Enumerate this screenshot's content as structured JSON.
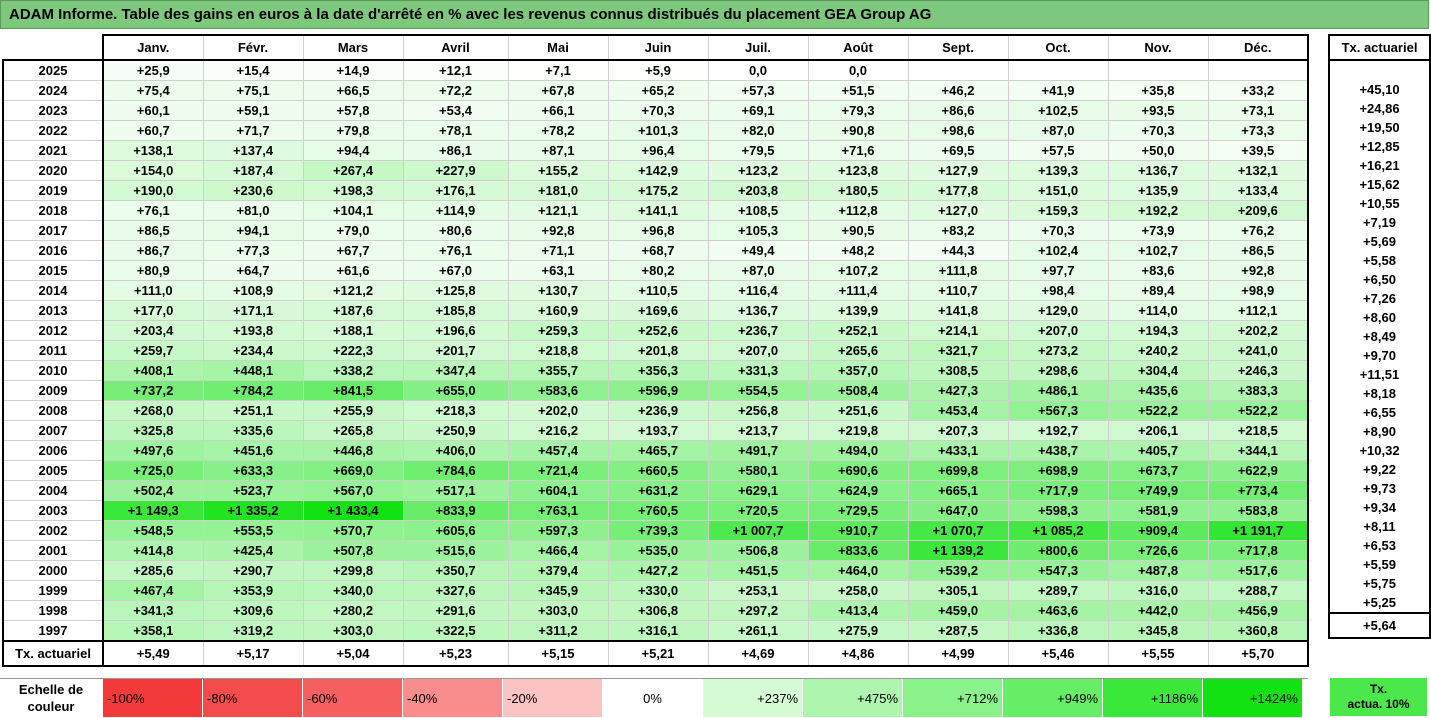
{
  "title": "ADAM Informe. Table des gains en euros à la date d'arrêté en % avec les revenus connus distribués du placement GEA Group AG",
  "months": [
    "Janv.",
    "Févr.",
    "Mars",
    "Avril",
    "Mai",
    "Juin",
    "Juil.",
    "Août",
    "Sept.",
    "Oct.",
    "Nov.",
    "Déc."
  ],
  "rate_header": "Tx. actuariel",
  "rows": [
    {
      "year": "2025",
      "values": [
        "+25,9",
        "+15,4",
        "+14,9",
        "+12,1",
        "+7,1",
        "+5,9",
        "0,0",
        "0,0",
        "",
        "",
        "",
        ""
      ],
      "rate": ""
    },
    {
      "year": "2024",
      "values": [
        "+75,4",
        "+75,1",
        "+66,5",
        "+72,2",
        "+67,8",
        "+65,2",
        "+57,3",
        "+51,5",
        "+46,2",
        "+41,9",
        "+35,8",
        "+33,2"
      ],
      "rate": "+45,10"
    },
    {
      "year": "2023",
      "values": [
        "+60,1",
        "+59,1",
        "+57,8",
        "+53,4",
        "+66,1",
        "+70,3",
        "+69,1",
        "+79,3",
        "+86,6",
        "+102,5",
        "+93,5",
        "+73,1"
      ],
      "rate": "+24,86"
    },
    {
      "year": "2022",
      "values": [
        "+60,7",
        "+71,7",
        "+79,8",
        "+78,1",
        "+78,2",
        "+101,3",
        "+82,0",
        "+90,8",
        "+98,6",
        "+87,0",
        "+70,3",
        "+73,3"
      ],
      "rate": "+19,50"
    },
    {
      "year": "2021",
      "values": [
        "+138,1",
        "+137,4",
        "+94,4",
        "+86,1",
        "+87,1",
        "+96,4",
        "+79,5",
        "+71,6",
        "+69,5",
        "+57,5",
        "+50,0",
        "+39,5"
      ],
      "rate": "+12,85"
    },
    {
      "year": "2020",
      "values": [
        "+154,0",
        "+187,4",
        "+267,4",
        "+227,9",
        "+155,2",
        "+142,9",
        "+123,2",
        "+123,8",
        "+127,9",
        "+139,3",
        "+136,7",
        "+132,1"
      ],
      "rate": "+16,21"
    },
    {
      "year": "2019",
      "values": [
        "+190,0",
        "+230,6",
        "+198,3",
        "+176,1",
        "+181,0",
        "+175,2",
        "+203,8",
        "+180,5",
        "+177,8",
        "+151,0",
        "+135,9",
        "+133,4"
      ],
      "rate": "+15,62"
    },
    {
      "year": "2018",
      "values": [
        "+76,1",
        "+81,0",
        "+104,1",
        "+114,9",
        "+121,1",
        "+141,1",
        "+108,5",
        "+112,8",
        "+127,0",
        "+159,3",
        "+192,2",
        "+209,6"
      ],
      "rate": "+10,55"
    },
    {
      "year": "2017",
      "values": [
        "+86,5",
        "+94,1",
        "+79,0",
        "+80,6",
        "+92,8",
        "+96,8",
        "+105,3",
        "+90,5",
        "+83,2",
        "+70,3",
        "+73,9",
        "+76,2"
      ],
      "rate": "+7,19"
    },
    {
      "year": "2016",
      "values": [
        "+86,7",
        "+77,3",
        "+67,7",
        "+76,1",
        "+71,1",
        "+68,7",
        "+49,4",
        "+48,2",
        "+44,3",
        "+102,4",
        "+102,7",
        "+86,5"
      ],
      "rate": "+5,69"
    },
    {
      "year": "2015",
      "values": [
        "+80,9",
        "+64,7",
        "+61,6",
        "+67,0",
        "+63,1",
        "+80,2",
        "+87,0",
        "+107,2",
        "+111,8",
        "+97,7",
        "+83,6",
        "+92,8"
      ],
      "rate": "+5,58"
    },
    {
      "year": "2014",
      "values": [
        "+111,0",
        "+108,9",
        "+121,2",
        "+125,8",
        "+130,7",
        "+110,5",
        "+116,4",
        "+111,4",
        "+110,7",
        "+98,4",
        "+89,4",
        "+98,9"
      ],
      "rate": "+6,50"
    },
    {
      "year": "2013",
      "values": [
        "+177,0",
        "+171,1",
        "+187,6",
        "+185,8",
        "+160,9",
        "+169,6",
        "+136,7",
        "+139,9",
        "+141,8",
        "+129,0",
        "+114,0",
        "+112,1"
      ],
      "rate": "+7,26"
    },
    {
      "year": "2012",
      "values": [
        "+203,4",
        "+193,8",
        "+188,1",
        "+196,6",
        "+259,3",
        "+252,6",
        "+236,7",
        "+252,1",
        "+214,1",
        "+207,0",
        "+194,3",
        "+202,2"
      ],
      "rate": "+8,60"
    },
    {
      "year": "2011",
      "values": [
        "+259,7",
        "+234,4",
        "+222,3",
        "+201,7",
        "+218,8",
        "+201,8",
        "+207,0",
        "+265,6",
        "+321,7",
        "+273,2",
        "+240,2",
        "+241,0"
      ],
      "rate": "+8,49"
    },
    {
      "year": "2010",
      "values": [
        "+408,1",
        "+448,1",
        "+338,2",
        "+347,4",
        "+355,7",
        "+356,3",
        "+331,3",
        "+357,0",
        "+308,5",
        "+298,6",
        "+304,4",
        "+246,3"
      ],
      "rate": "+9,70"
    },
    {
      "year": "2009",
      "values": [
        "+737,2",
        "+784,2",
        "+841,5",
        "+655,0",
        "+583,6",
        "+596,9",
        "+554,5",
        "+508,4",
        "+427,3",
        "+486,1",
        "+435,6",
        "+383,3"
      ],
      "rate": "+11,51"
    },
    {
      "year": "2008",
      "values": [
        "+268,0",
        "+251,1",
        "+255,9",
        "+218,3",
        "+202,0",
        "+236,9",
        "+256,8",
        "+251,6",
        "+453,4",
        "+567,3",
        "+522,2",
        "+522,2"
      ],
      "rate": "+8,18"
    },
    {
      "year": "2007",
      "values": [
        "+325,8",
        "+335,6",
        "+265,8",
        "+250,9",
        "+216,2",
        "+193,7",
        "+213,7",
        "+219,8",
        "+207,3",
        "+192,7",
        "+206,1",
        "+218,5"
      ],
      "rate": "+6,55"
    },
    {
      "year": "2006",
      "values": [
        "+497,6",
        "+451,6",
        "+446,8",
        "+406,0",
        "+457,4",
        "+465,7",
        "+491,7",
        "+494,0",
        "+433,1",
        "+438,7",
        "+405,7",
        "+344,1"
      ],
      "rate": "+8,90"
    },
    {
      "year": "2005",
      "values": [
        "+725,0",
        "+633,3",
        "+669,0",
        "+784,6",
        "+721,4",
        "+660,5",
        "+580,1",
        "+690,6",
        "+699,8",
        "+698,9",
        "+673,7",
        "+622,9"
      ],
      "rate": "+10,32"
    },
    {
      "year": "2004",
      "values": [
        "+502,4",
        "+523,7",
        "+567,0",
        "+517,1",
        "+604,1",
        "+631,2",
        "+629,1",
        "+624,9",
        "+665,1",
        "+717,9",
        "+749,9",
        "+773,4"
      ],
      "rate": "+9,22"
    },
    {
      "year": "2003",
      "values": [
        "+1 149,3",
        "+1 335,2",
        "+1 433,4",
        "+833,9",
        "+763,1",
        "+760,5",
        "+720,5",
        "+729,5",
        "+647,0",
        "+598,3",
        "+581,9",
        "+583,8"
      ],
      "rate": "+9,73"
    },
    {
      "year": "2002",
      "values": [
        "+548,5",
        "+553,5",
        "+570,7",
        "+605,6",
        "+597,3",
        "+739,3",
        "+1 007,7",
        "+910,7",
        "+1 070,7",
        "+1 085,2",
        "+909,4",
        "+1 191,7"
      ],
      "rate": "+9,34"
    },
    {
      "year": "2001",
      "values": [
        "+414,8",
        "+425,4",
        "+507,8",
        "+515,6",
        "+466,4",
        "+535,0",
        "+506,8",
        "+833,6",
        "+1 139,2",
        "+800,6",
        "+726,6",
        "+717,8"
      ],
      "rate": "+8,11"
    },
    {
      "year": "2000",
      "values": [
        "+285,6",
        "+290,7",
        "+299,8",
        "+350,7",
        "+379,4",
        "+427,2",
        "+451,5",
        "+464,0",
        "+539,2",
        "+547,3",
        "+487,8",
        "+517,6"
      ],
      "rate": "+6,53"
    },
    {
      "year": "1999",
      "values": [
        "+467,4",
        "+353,9",
        "+340,0",
        "+327,6",
        "+345,9",
        "+330,0",
        "+253,1",
        "+258,0",
        "+305,1",
        "+289,7",
        "+316,0",
        "+288,7"
      ],
      "rate": "+5,59"
    },
    {
      "year": "1998",
      "values": [
        "+341,3",
        "+309,6",
        "+280,2",
        "+291,6",
        "+303,0",
        "+306,8",
        "+297,2",
        "+413,4",
        "+459,0",
        "+463,6",
        "+442,0",
        "+456,9"
      ],
      "rate": "+5,75"
    },
    {
      "year": "1997",
      "values": [
        "+358,1",
        "+319,2",
        "+303,0",
        "+322,5",
        "+311,2",
        "+316,1",
        "+261,1",
        "+275,9",
        "+287,5",
        "+336,8",
        "+345,8",
        "+360,8"
      ],
      "rate": "+5,25"
    }
  ],
  "footer": {
    "label": "Tx. actuariel",
    "values": [
      "+5,49",
      "+5,17",
      "+5,04",
      "+5,23",
      "+5,15",
      "+5,21",
      "+4,69",
      "+4,86",
      "+4,99",
      "+5,46",
      "+5,55",
      "+5,70"
    ],
    "rate": "+5,64"
  },
  "scale": {
    "label_line1": "Echelle de",
    "label_line2": "couleur",
    "items": [
      {
        "label": "-100%",
        "color": "#f23a3a",
        "kind": "neg"
      },
      {
        "label": "-80%",
        "color": "#f44c4c",
        "kind": "neg"
      },
      {
        "label": "-60%",
        "color": "#f66060",
        "kind": "neg"
      },
      {
        "label": "-40%",
        "color": "#f98c8c",
        "kind": "neg"
      },
      {
        "label": "-20%",
        "color": "#fcc3c3",
        "kind": "neg"
      },
      {
        "label": "0%",
        "color": "#ffffff",
        "kind": "zero"
      },
      {
        "label": "+237%",
        "color": "#d6fcd6",
        "kind": "pos"
      },
      {
        "label": "+475%",
        "color": "#aef6ae",
        "kind": "pos"
      },
      {
        "label": "+712%",
        "color": "#8af28a",
        "kind": "pos"
      },
      {
        "label": "+949%",
        "color": "#66ee66",
        "kind": "pos"
      },
      {
        "label": "+1186%",
        "color": "#3ae83a",
        "kind": "pos"
      },
      {
        "label": "+1424%",
        "color": "#12e212",
        "kind": "pos"
      }
    ]
  },
  "rate_legend": {
    "line1": "Tx.",
    "line2": "actua. 10%",
    "color": "#4ae84a"
  }
}
